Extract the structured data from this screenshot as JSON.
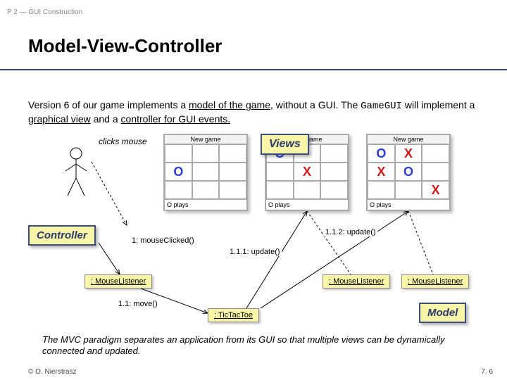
{
  "header": "P 2 — GUI Construction",
  "title": "Model-View-Controller",
  "intro": {
    "t1": "Version 6 of our game implements a ",
    "u1": "model of the game",
    "t2": ", without a GUI. The ",
    "code": "GameGUI",
    "t3": " will implement a ",
    "u2": "graphical view",
    "t4": " and a ",
    "u3": "controller for GUI events.",
    "t5": ""
  },
  "diagram": {
    "clicks": "clicks mouse",
    "win_title": "New game",
    "status": "O plays",
    "tags": {
      "views": "Views",
      "controller": "Controller",
      "model": "Model"
    },
    "uml": {
      "mouse": ": MouseListener",
      "ttt": ": TicTacToe"
    },
    "labels": {
      "mouseClicked": "1: mouseClicked()",
      "update1": "1.1.1: update()",
      "update2": "1.1.2: update()",
      "move": "1.1: move()"
    },
    "board1": [
      "",
      "",
      "",
      "O",
      "",
      "",
      "",
      "",
      ""
    ],
    "board2": [
      "O",
      "",
      "",
      "",
      "X",
      "",
      "",
      "",
      ""
    ],
    "board3": [
      "O",
      "X",
      "",
      "X",
      "O",
      "",
      "",
      "",
      "X"
    ]
  },
  "summary": "The MVC paradigm separates an application from its GUI so that multiple views can be dynamically connected and updated.",
  "copyright": "© O. Nierstrasz",
  "pagenum": "7. 6"
}
